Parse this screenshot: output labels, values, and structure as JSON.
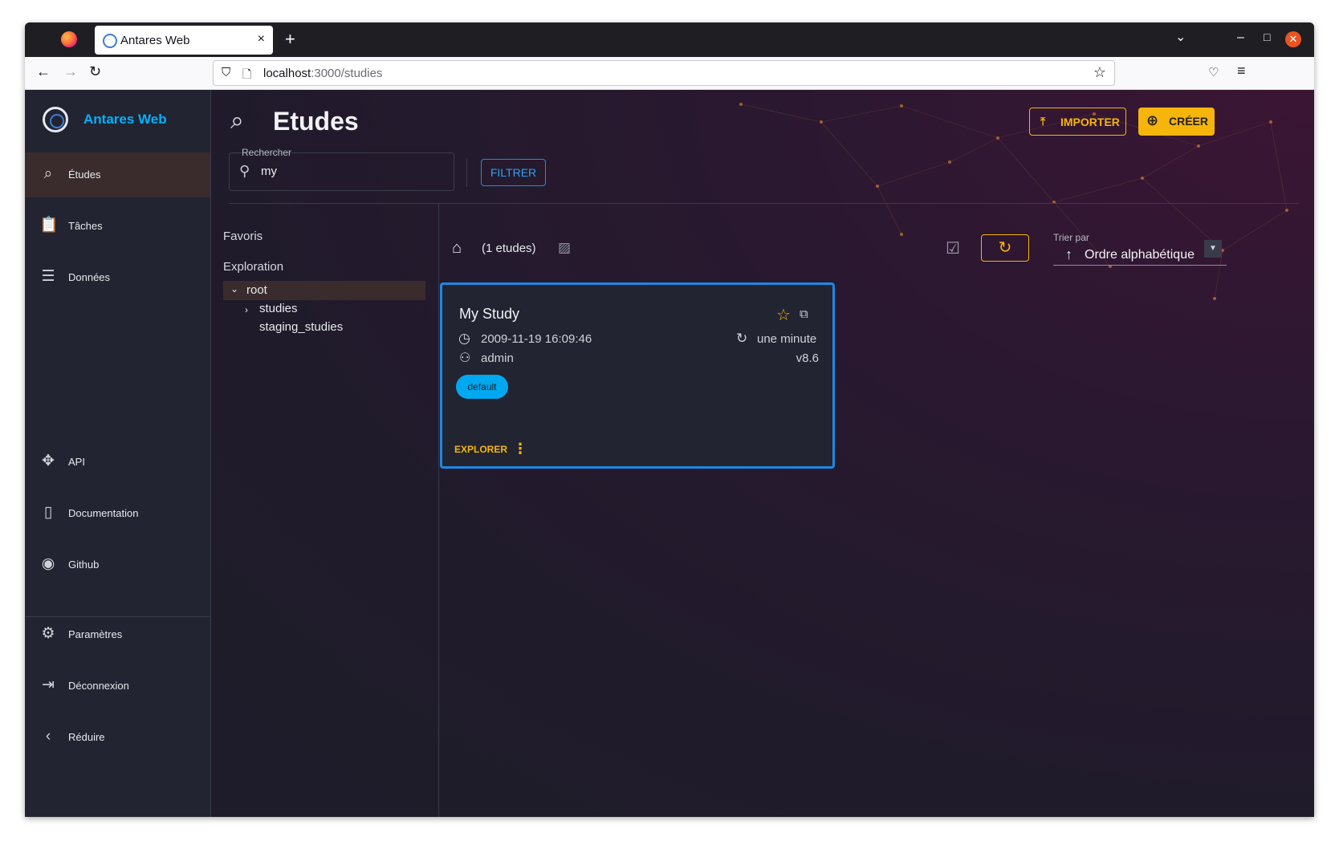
{
  "browser": {
    "tab_title": "Antares Web",
    "new_tab": "+",
    "url_host": "localhost",
    "url_path": ":3000/studies",
    "tab_close": "×"
  },
  "sidebar": {
    "brand": "Antares Web",
    "items": [
      {
        "label": "Études",
        "icon": "study-search-icon",
        "active": true
      },
      {
        "label": "Tâches",
        "icon": "clipboard-icon"
      },
      {
        "label": "Données",
        "icon": "storage-icon"
      },
      {
        "label": "API",
        "icon": "api-icon"
      },
      {
        "label": "Documentation",
        "icon": "book-icon"
      },
      {
        "label": "Github",
        "icon": "github-icon"
      },
      {
        "label": "Paramètres",
        "icon": "gear-icon"
      },
      {
        "label": "Déconnexion",
        "icon": "logout-icon"
      },
      {
        "label": "Réduire",
        "icon": "chevron-left-icon"
      }
    ]
  },
  "header": {
    "title": "Etudes",
    "import_label": "IMPORTER",
    "create_label": "CRÉER"
  },
  "search": {
    "label": "Rechercher",
    "value": "my",
    "filter_label": "FILTRER"
  },
  "tree": {
    "favorites": "Favoris",
    "exploration": "Exploration",
    "root": "root",
    "children": [
      "studies",
      "staging_studies"
    ]
  },
  "list": {
    "count": "(1 etudes)",
    "sort_label": "Trier par",
    "sort_value": "Ordre alphabétique"
  },
  "study": {
    "title": "My Study",
    "created": "2009-11-19 16:09:46",
    "modified": "une minute",
    "owner": "admin",
    "version": "v8.6",
    "tag": "default",
    "explore_label": "EXPLORER"
  },
  "colors": {
    "accent": "#f5b50a",
    "brand": "#00b2ff",
    "card_border": "#1e88e5",
    "tag": "#00a8f0"
  }
}
